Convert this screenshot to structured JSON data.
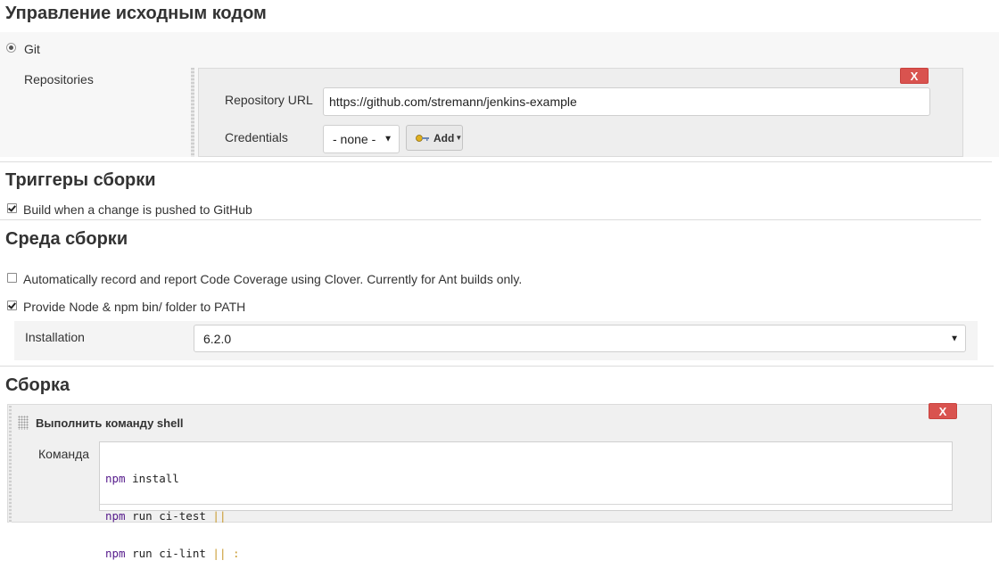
{
  "scm": {
    "title": "Управление исходным кодом",
    "git_label": "Git",
    "repositories_label": "Repositories",
    "delete_label": "X",
    "repo_url_label": "Repository URL",
    "repo_url_value": "https://github.com/stremann/jenkins-example",
    "credentials_label": "Credentials",
    "credentials_value": "- none -",
    "add_label": "Add"
  },
  "triggers": {
    "title": "Триггеры сборки",
    "github_push_label": "Build when a change is pushed to GitHub",
    "github_push_checked": true
  },
  "environment": {
    "title": "Среда сборки",
    "clover_label": "Automatically record and report Code Coverage using Clover. Currently for Ant builds only.",
    "clover_checked": false,
    "node_label": "Provide Node & npm bin/ folder to PATH",
    "node_checked": true,
    "installation_label": "Installation",
    "installation_value": "6.2.0"
  },
  "build": {
    "title": "Сборка",
    "step_title": "Выполнить команду shell",
    "delete_label": "X",
    "command_label": "Команда",
    "command_lines": [
      {
        "cmd": "npm",
        "rest": " install",
        "suffix": ""
      },
      {
        "cmd": "npm",
        "rest": " run ci-test",
        "suffix": " ||"
      },
      {
        "cmd": "npm",
        "rest": " run ci-lint",
        "suffix": " || :"
      }
    ]
  },
  "icons": {
    "radio": "radio-selected-icon",
    "check": "checkbox-icon",
    "key": "key-icon",
    "drag": "drag-handle-icon",
    "dropdown": "chevron-down-icon"
  },
  "colors": {
    "delete_button": "#d9534f",
    "panel_bg": "#f0f0f0"
  }
}
